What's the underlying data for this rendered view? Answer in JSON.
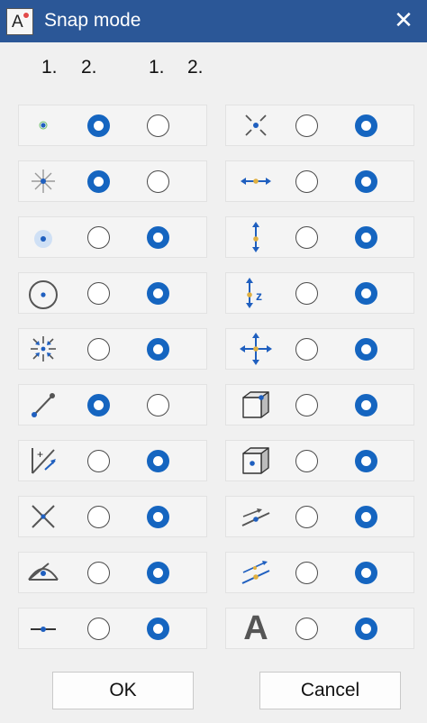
{
  "window": {
    "title": "Snap mode",
    "close_label": "✕",
    "icon_letter": "A"
  },
  "columns": {
    "left": {
      "first": "1.",
      "second": "2."
    },
    "right": {
      "first": "1.",
      "second": "2."
    }
  },
  "rows": [
    {
      "left": {
        "icon": "point-icon",
        "first": true,
        "second": false
      },
      "right": {
        "icon": "intersection-icon",
        "first": false,
        "second": true
      }
    },
    {
      "left": {
        "icon": "center-point-icon",
        "first": true,
        "second": false
      },
      "right": {
        "icon": "horizontal-midpoint-icon",
        "first": false,
        "second": true
      }
    },
    {
      "left": {
        "icon": "highlighted-point-icon",
        "first": false,
        "second": true
      },
      "right": {
        "icon": "vertical-midpoint-icon",
        "first": false,
        "second": true
      }
    },
    {
      "left": {
        "icon": "circle-center-icon",
        "first": false,
        "second": true
      },
      "right": {
        "icon": "z-axis-icon",
        "first": false,
        "second": true
      }
    },
    {
      "left": {
        "icon": "collapse-arrows-icon",
        "first": false,
        "second": true
      },
      "right": {
        "icon": "four-way-arrows-icon",
        "first": false,
        "second": true
      }
    },
    {
      "left": {
        "icon": "line-endpoints-icon",
        "first": true,
        "second": false
      },
      "right": {
        "icon": "cube-vertex-icon",
        "first": false,
        "second": true
      }
    },
    {
      "left": {
        "icon": "angle-plus-icon",
        "first": false,
        "second": true
      },
      "right": {
        "icon": "cube-face-center-icon",
        "first": false,
        "second": true
      }
    },
    {
      "left": {
        "icon": "cross-icon",
        "first": false,
        "second": true
      },
      "right": {
        "icon": "line-on-line-icon",
        "first": false,
        "second": true
      }
    },
    {
      "left": {
        "icon": "eye-angle-icon",
        "first": false,
        "second": true
      },
      "right": {
        "icon": "parallel-lines-icon",
        "first": false,
        "second": true
      }
    },
    {
      "left": {
        "icon": "line-midpoint-icon",
        "first": false,
        "second": true
      },
      "right": {
        "icon": "text-icon",
        "first": false,
        "second": true,
        "glyph": "A"
      }
    }
  ],
  "buttons": {
    "ok": "OK",
    "cancel": "Cancel"
  },
  "colors": {
    "titlebar": "#2b5797",
    "accent": "#1565c0",
    "snap_point": "#1f5fbf",
    "midpoint": "#e0b040",
    "icon_gray": "#555555"
  }
}
